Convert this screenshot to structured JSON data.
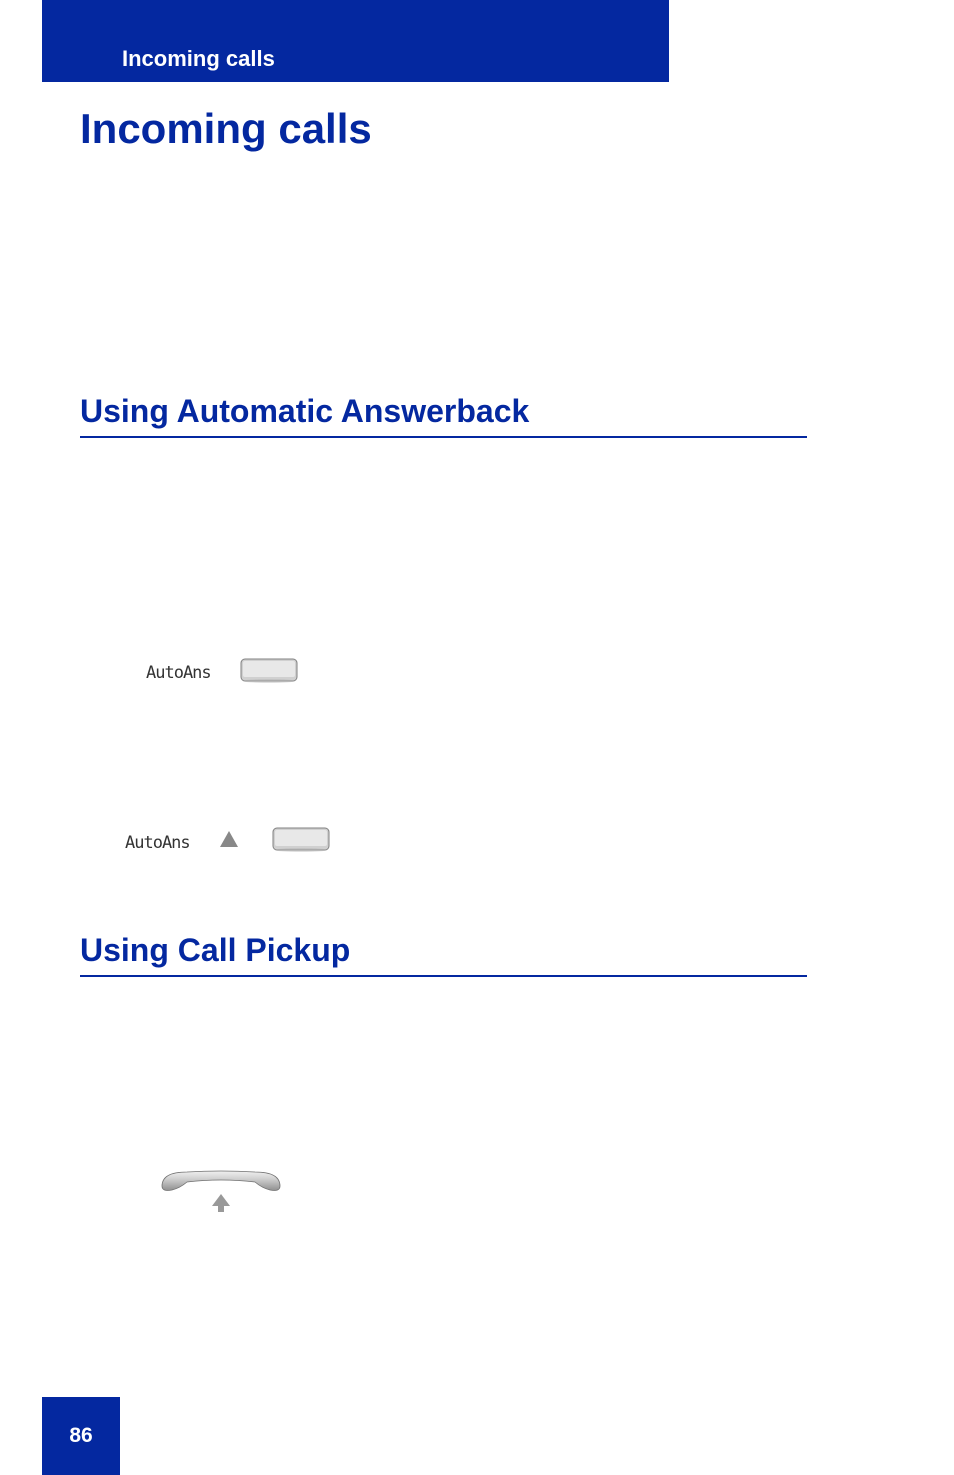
{
  "header": {
    "breadcrumb": "Incoming calls"
  },
  "title": "Incoming calls",
  "sections": {
    "answerback": {
      "heading": "Using Automatic Answerback",
      "label1": "AutoAns",
      "label2": "AutoAns"
    },
    "pickup": {
      "heading": "Using Call Pickup"
    }
  },
  "icons": {
    "softkey_button": "soft-key-button",
    "person_triangle": "indicator-icon",
    "handset": "handset-icon"
  },
  "page_number": "86"
}
